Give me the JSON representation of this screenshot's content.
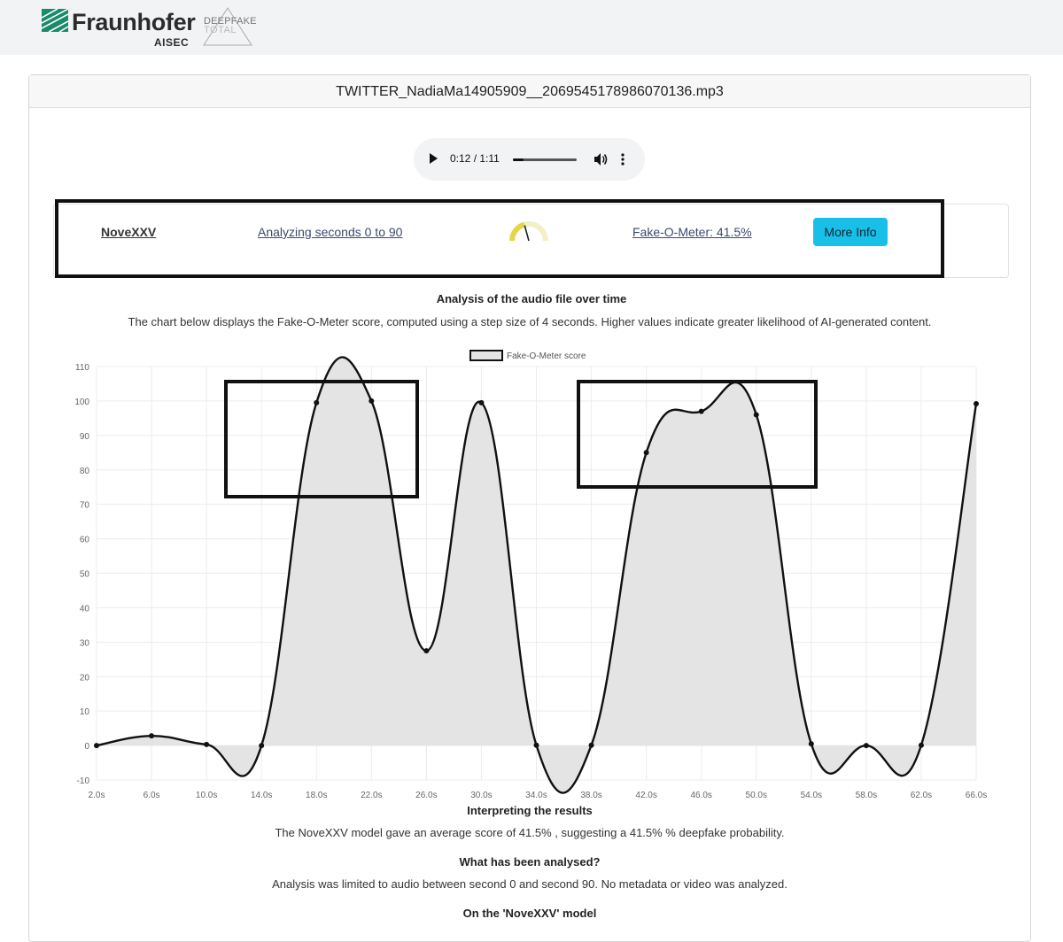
{
  "brand": {
    "name": "Fraunhofer",
    "sub": "AISEC",
    "product_top": "DEEPFAKE",
    "product_bottom": "TOTAL",
    "logo_color": "#1a8a6a"
  },
  "file": {
    "title": "TWITTER_NadiaMa14905909__2069545178986070136.mp3"
  },
  "audio_player": {
    "time": "0:12 / 1:11",
    "progress": 0.17
  },
  "result": {
    "model": "NoveXXV",
    "range": "Analyzing seconds 0 to 90",
    "fake_o_meter": "Fake-O-Meter: 41.5%",
    "score_percent": 41.5,
    "more_info_label": "More Info",
    "accent_color": "#18c0e8"
  },
  "analysis": {
    "title": "Analysis of the audio file over time",
    "description": "The chart below displays the Fake-O-Meter score, computed using a step size of 4 seconds. Higher values indicate greater likelihood of AI-generated content."
  },
  "chart_data": {
    "type": "line",
    "legend": "Fake-O-Meter score",
    "legend_position": "top-center",
    "categories": [
      "2.0s",
      "6.0s",
      "10.0s",
      "14.0s",
      "18.0s",
      "22.0s",
      "26.0s",
      "30.0s",
      "34.0s",
      "38.0s",
      "42.0s",
      "46.0s",
      "50.0s",
      "54.0s",
      "58.0s",
      "62.0s",
      "66.0s"
    ],
    "values": [
      0,
      2.8,
      0.3,
      0,
      99.5,
      100,
      27.5,
      99.5,
      0.1,
      0.1,
      85,
      97,
      96,
      0.5,
      0,
      0.1,
      99.2
    ],
    "ylim": [
      -10,
      110
    ],
    "yticks": [
      -10,
      0,
      10,
      20,
      30,
      40,
      50,
      60,
      70,
      80,
      90,
      100,
      110
    ],
    "grid": true,
    "fill": true,
    "line_color": "#111111",
    "fill_color": "#e4e4e4"
  },
  "interpretation": {
    "title": "Interpreting the results",
    "text": "The NoveXXV model gave an average score of 41.5% , suggesting a 41.5% % deepfake probability."
  },
  "analysed": {
    "title": "What has been analysed?",
    "text": "Analysis was limited to audio between second 0 and second 90. No metadata or video was analyzed."
  },
  "about_model": {
    "title": "On the 'NoveXXV' model"
  }
}
